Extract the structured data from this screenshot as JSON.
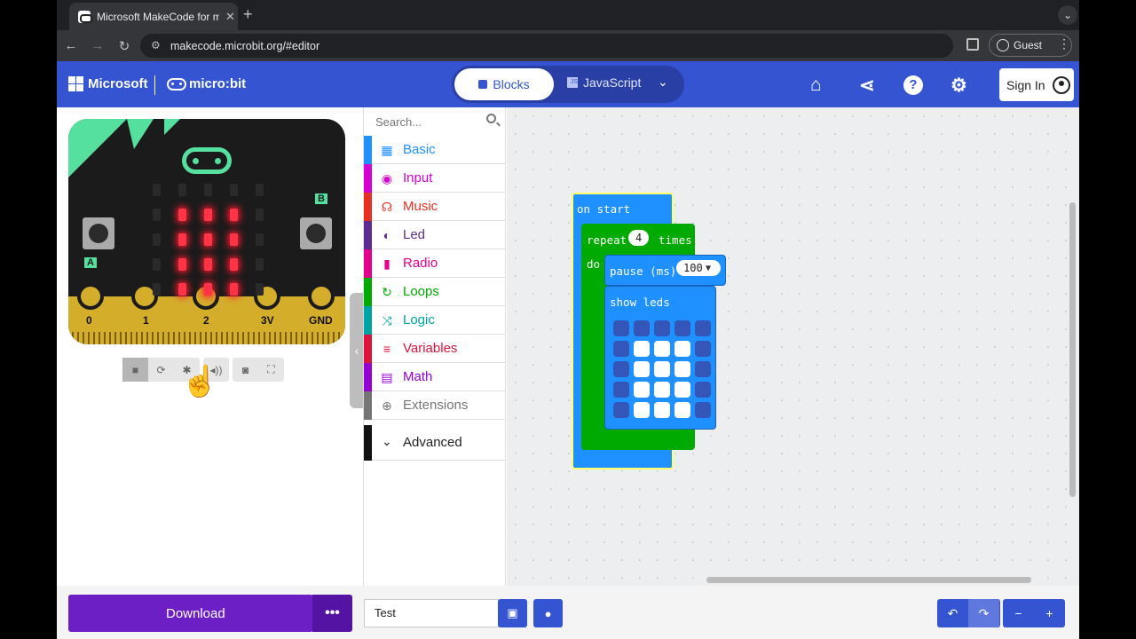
{
  "browser": {
    "tab_title": "Microsoft MakeCode for micro:bit",
    "url": "makecode.microbit.org/#editor",
    "guest_label": "Guest"
  },
  "header": {
    "microsoft_label": "Microsoft",
    "microbit_label": "micro:bit",
    "blocks_tab": "Blocks",
    "javascript_tab": "JavaScript",
    "sign_in": "Sign In"
  },
  "simulator": {
    "pins": [
      "0",
      "1",
      "2",
      "3V",
      "GND"
    ],
    "button_a": "A",
    "button_b": "B",
    "leds": [
      [
        0,
        0,
        0,
        0,
        0
      ],
      [
        0,
        1,
        1,
        1,
        0
      ],
      [
        0,
        1,
        1,
        1,
        0
      ],
      [
        0,
        1,
        1,
        1,
        0
      ],
      [
        0,
        1,
        1,
        1,
        0
      ]
    ]
  },
  "toolbox": {
    "search_placeholder": "Search...",
    "categories": [
      {
        "label": "Basic",
        "color": "#1e90ff",
        "icon": "grid-icon"
      },
      {
        "label": "Input",
        "color": "#d400d4",
        "icon": "target-icon"
      },
      {
        "label": "Music",
        "color": "#e63022",
        "icon": "headphones-icon"
      },
      {
        "label": "Led",
        "color": "#5c2d91",
        "icon": "toggle-icon"
      },
      {
        "label": "Radio",
        "color": "#e3008c",
        "icon": "signal-icon"
      },
      {
        "label": "Loops",
        "color": "#00aa00",
        "icon": "refresh-icon"
      },
      {
        "label": "Logic",
        "color": "#00a4a6",
        "icon": "shuffle-icon"
      },
      {
        "label": "Variables",
        "color": "#dc143c",
        "icon": "list-icon"
      },
      {
        "label": "Math",
        "color": "#9400d3",
        "icon": "calculator-icon"
      },
      {
        "label": "Extensions",
        "color": "#757575",
        "icon": "plus-circle-icon"
      }
    ],
    "advanced": "Advanced"
  },
  "workspace": {
    "on_start": "on start",
    "repeat": "repeat",
    "repeat_count": "4",
    "times": "times",
    "do": "do",
    "pause": "pause (ms)",
    "pause_value": "100",
    "show_leds": "show leds",
    "leds": [
      [
        0,
        0,
        0,
        0,
        0
      ],
      [
        0,
        1,
        1,
        1,
        0
      ],
      [
        0,
        1,
        1,
        1,
        0
      ],
      [
        0,
        1,
        1,
        1,
        0
      ],
      [
        0,
        1,
        1,
        1,
        0
      ]
    ]
  },
  "footer": {
    "download": "Download",
    "more": "•••",
    "project_name": "Test"
  }
}
